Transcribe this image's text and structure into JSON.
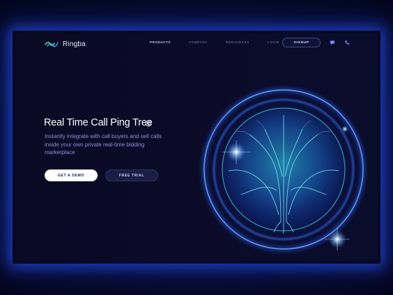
{
  "brand": {
    "name": "Ringba"
  },
  "nav": {
    "items": [
      {
        "label": "PRODUCTS",
        "active": true
      },
      {
        "label": "COMPANY",
        "active": false
      },
      {
        "label": "RESOURCES",
        "active": false
      },
      {
        "label": "LOGIN",
        "active": false
      }
    ],
    "signup_label": "SIGNUP"
  },
  "icons": {
    "chat": "chat-bubble-icon",
    "phone": "phone-icon"
  },
  "hero": {
    "headline": "Real Time Call Ping Tree",
    "subtext": "Instantly integrate with call buyers and sell calls inside your own private real-time bidding marketplace",
    "cta_primary": "GET A DEMO",
    "cta_secondary": "FREE TRIAL"
  },
  "colors": {
    "background": "#0a0a24",
    "accent_glow": "#2f6bff",
    "teal": "#3fe0d0",
    "subtext": "#8c8fd6"
  }
}
